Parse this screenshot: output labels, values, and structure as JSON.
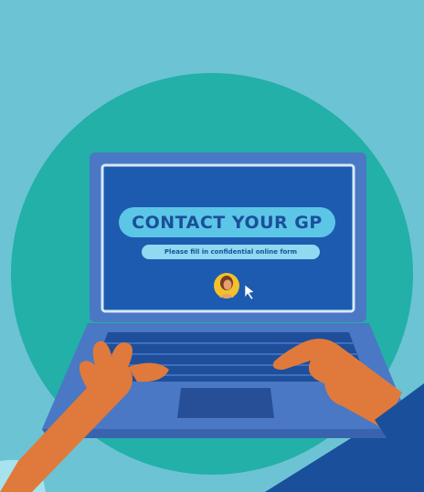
{
  "screen": {
    "title": "CONTACT YOUR GP",
    "subtitle": "Please fill in confidential online form"
  },
  "colors": {
    "background": "#6cc3d4",
    "circle": "#22b0a8",
    "laptop_body": "#4a78c4",
    "screen": "#1d5bb0",
    "keyboard": "#1f4f9a",
    "skin": "#e07a3c",
    "corner_panel": "#1a4f9c"
  },
  "icons": {
    "avatar": "user-avatar-icon",
    "cursor": "mouse-cursor-icon"
  }
}
